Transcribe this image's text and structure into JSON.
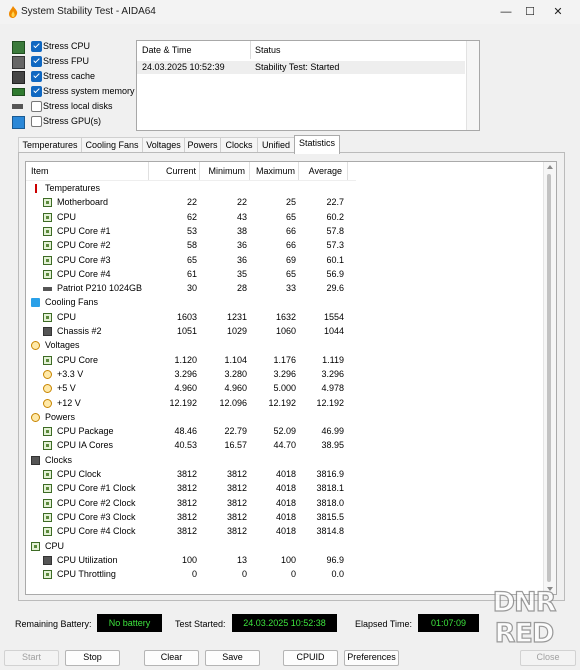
{
  "window": {
    "title": "System Stability Test - AIDA64",
    "controls": {
      "minimize": "—",
      "maximize": "☐",
      "close": "✕"
    }
  },
  "stress_options": [
    {
      "label": "Stress CPU",
      "checked": true,
      "icon": "cpu-icon"
    },
    {
      "label": "Stress FPU",
      "checked": true,
      "icon": "fpu-icon"
    },
    {
      "label": "Stress cache",
      "checked": true,
      "icon": "cache-icon"
    },
    {
      "label": "Stress system memory",
      "checked": true,
      "icon": "memory-icon"
    },
    {
      "label": "Stress local disks",
      "checked": false,
      "icon": "disk-icon"
    },
    {
      "label": "Stress GPU(s)",
      "checked": false,
      "icon": "gpu-icon"
    }
  ],
  "status_log": {
    "headers": {
      "datetime": "Date & Time",
      "status": "Status"
    },
    "rows": [
      {
        "datetime": "24.03.2025 10:52:39",
        "status": "Stability Test: Started"
      }
    ]
  },
  "tabs": [
    "Temperatures",
    "Cooling Fans",
    "Voltages",
    "Powers",
    "Clocks",
    "Unified",
    "Statistics"
  ],
  "active_tab": "Statistics",
  "stats_table": {
    "columns": {
      "item": "Item",
      "current": "Current",
      "minimum": "Minimum",
      "maximum": "Maximum",
      "average": "Average"
    },
    "rows": [
      {
        "kind": "group",
        "icon": "thermometer-icon",
        "name": "Temperatures"
      },
      {
        "kind": "item",
        "icon": "motherboard-icon",
        "name": "Motherboard",
        "current": "22",
        "minimum": "22",
        "maximum": "25",
        "average": "22.7"
      },
      {
        "kind": "item",
        "icon": "cpu-icon",
        "name": "CPU",
        "current": "62",
        "minimum": "43",
        "maximum": "65",
        "average": "60.2"
      },
      {
        "kind": "item",
        "icon": "cpu-icon",
        "name": "CPU Core #1",
        "current": "53",
        "minimum": "38",
        "maximum": "66",
        "average": "57.8"
      },
      {
        "kind": "item",
        "icon": "cpu-icon",
        "name": "CPU Core #2",
        "current": "58",
        "minimum": "36",
        "maximum": "66",
        "average": "57.3"
      },
      {
        "kind": "item",
        "icon": "cpu-icon",
        "name": "CPU Core #3",
        "current": "65",
        "minimum": "36",
        "maximum": "69",
        "average": "60.1"
      },
      {
        "kind": "item",
        "icon": "cpu-icon",
        "name": "CPU Core #4",
        "current": "61",
        "minimum": "35",
        "maximum": "65",
        "average": "56.9"
      },
      {
        "kind": "item",
        "icon": "hdd-icon",
        "name": "Patriot P210 1024GB",
        "current": "30",
        "minimum": "28",
        "maximum": "33",
        "average": "29.6"
      },
      {
        "kind": "group",
        "icon": "fan-icon",
        "name": "Cooling Fans"
      },
      {
        "kind": "item",
        "icon": "cpu-icon",
        "name": "CPU",
        "current": "1603",
        "minimum": "1231",
        "maximum": "1632",
        "average": "1554"
      },
      {
        "kind": "item",
        "icon": "chassis-icon",
        "name": "Chassis #2",
        "current": "1051",
        "minimum": "1029",
        "maximum": "1060",
        "average": "1044"
      },
      {
        "kind": "group",
        "icon": "voltage-icon",
        "name": "Voltages"
      },
      {
        "kind": "item",
        "icon": "cpu-icon",
        "name": "CPU Core",
        "current": "1.120",
        "minimum": "1.104",
        "maximum": "1.176",
        "average": "1.119"
      },
      {
        "kind": "item",
        "icon": "voltage-icon",
        "name": "+3.3 V",
        "current": "3.296",
        "minimum": "3.280",
        "maximum": "3.296",
        "average": "3.296"
      },
      {
        "kind": "item",
        "icon": "voltage-icon",
        "name": "+5 V",
        "current": "4.960",
        "minimum": "4.960",
        "maximum": "5.000",
        "average": "4.978"
      },
      {
        "kind": "item",
        "icon": "voltage-icon",
        "name": "+12 V",
        "current": "12.192",
        "minimum": "12.096",
        "maximum": "12.192",
        "average": "12.192"
      },
      {
        "kind": "group",
        "icon": "power-icon",
        "name": "Powers"
      },
      {
        "kind": "item",
        "icon": "cpu-icon",
        "name": "CPU Package",
        "current": "48.46",
        "minimum": "22.79",
        "maximum": "52.09",
        "average": "46.99"
      },
      {
        "kind": "item",
        "icon": "cpu-icon",
        "name": "CPU IA Cores",
        "current": "40.53",
        "minimum": "16.57",
        "maximum": "44.70",
        "average": "38.95"
      },
      {
        "kind": "group",
        "icon": "clock-icon",
        "name": "Clocks"
      },
      {
        "kind": "item",
        "icon": "cpu-icon",
        "name": "CPU Clock",
        "current": "3812",
        "minimum": "3812",
        "maximum": "4018",
        "average": "3816.9"
      },
      {
        "kind": "item",
        "icon": "cpu-icon",
        "name": "CPU Core #1 Clock",
        "current": "3812",
        "minimum": "3812",
        "maximum": "4018",
        "average": "3818.1"
      },
      {
        "kind": "item",
        "icon": "cpu-icon",
        "name": "CPU Core #2 Clock",
        "current": "3812",
        "minimum": "3812",
        "maximum": "4018",
        "average": "3818.0"
      },
      {
        "kind": "item",
        "icon": "cpu-icon",
        "name": "CPU Core #3 Clock",
        "current": "3812",
        "minimum": "3812",
        "maximum": "4018",
        "average": "3815.5"
      },
      {
        "kind": "item",
        "icon": "cpu-icon",
        "name": "CPU Core #4 Clock",
        "current": "3812",
        "minimum": "3812",
        "maximum": "4018",
        "average": "3814.8"
      },
      {
        "kind": "group",
        "icon": "cpu-icon",
        "name": "CPU"
      },
      {
        "kind": "item",
        "icon": "hourglass-icon",
        "name": "CPU Utilization",
        "current": "100",
        "minimum": "13",
        "maximum": "100",
        "average": "96.9"
      },
      {
        "kind": "item",
        "icon": "cpu-icon",
        "name": "CPU Throttling",
        "current": "0",
        "minimum": "0",
        "maximum": "0",
        "average": "0.0"
      }
    ]
  },
  "status_bar": {
    "battery_label": "Remaining Battery:",
    "battery_value": "No battery",
    "started_label": "Test Started:",
    "started_value": "24.03.2025 10:52:38",
    "elapsed_label": "Elapsed Time:",
    "elapsed_value": "01:07:09"
  },
  "buttons": {
    "start": "Start",
    "stop": "Stop",
    "clear": "Clear",
    "save": "Save",
    "cpuid": "CPUID",
    "preferences": "Preferences",
    "close": "Close"
  },
  "watermark": {
    "line1": "DNR",
    "line2": "RED"
  },
  "colors": {
    "checkbox_accent": "#0f67c1",
    "lcd_text": "#3de33d",
    "lcd_bg": "#000000"
  }
}
